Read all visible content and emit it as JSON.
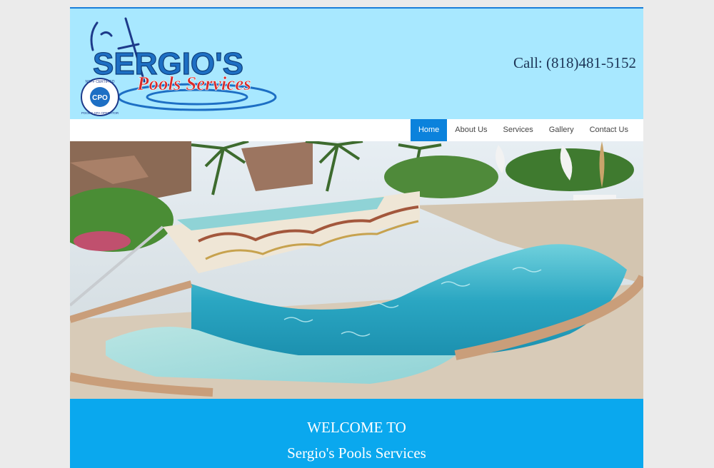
{
  "header": {
    "logo_title": "SERGIO'S",
    "logo_subtitle": "Pools Services",
    "badge_top": "NSPF CERTIFIED",
    "badge_mid": "CPO",
    "badge_bottom": "POOL & SPA OPERATOR",
    "phone": "Call: (818)481-5152"
  },
  "nav": {
    "items": [
      {
        "label": "Home"
      },
      {
        "label": "About Us"
      },
      {
        "label": "Services"
      },
      {
        "label": "Gallery"
      },
      {
        "label": "Contact Us"
      }
    ]
  },
  "welcome": {
    "line1": "WELCOME TO",
    "line2": "Sergio's Pools Services"
  },
  "colors": {
    "header_bg": "#a8e8ff",
    "nav_active": "#0b82dc",
    "welcome_bg": "#0aa8ee",
    "logo_blue": "#1d6fc4",
    "logo_red": "#d62b2b"
  }
}
